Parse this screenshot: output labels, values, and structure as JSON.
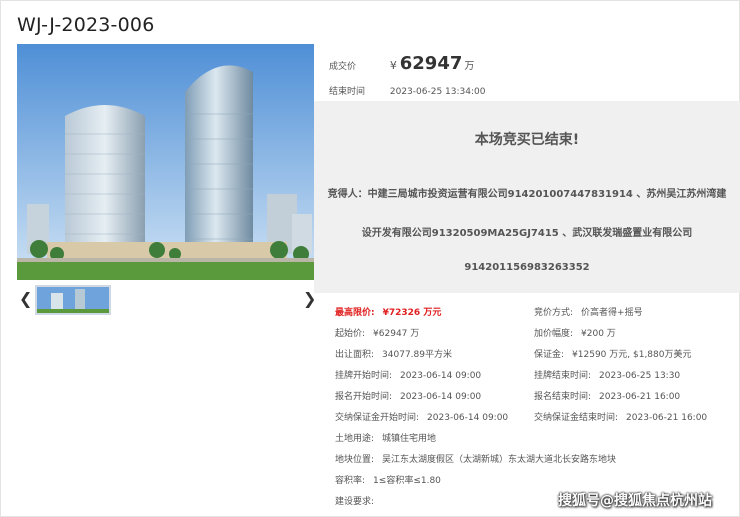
{
  "lot": {
    "code": "WJ-J-2023-006"
  },
  "summary": {
    "deal_price_label": "成交价",
    "currency": "¥",
    "deal_price": "62947",
    "unit": "万",
    "end_time_label": "结束时间",
    "end_time": "2023-06-25 13:34:00"
  },
  "ended": {
    "title": "本场竞买已结束!",
    "winner_lines": [
      "竞得人：中建三局城市投资运营有限公司914201007447831914 、苏州吴江苏州湾建",
      "设开发有限公司91320509MA25GJ7415 、武汉联发瑞盛置业有限公司",
      "914201156983263352"
    ]
  },
  "details": {
    "max_price_label": "最高限价:",
    "max_price": "¥72326 万元",
    "bid_method_label": "竞价方式:",
    "bid_method": "价高者得+摇号",
    "start_price_label": "起始价:",
    "start_price": "¥62947 万",
    "increment_label": "加价幅度:",
    "increment": "¥200 万",
    "area_label": "出让面积:",
    "area": "34077.89平方米",
    "deposit_label": "保证金:",
    "deposit": "¥12590 万元, $1,880万美元",
    "list_start_label": "挂牌开始时间:",
    "list_start": "2023-06-14 09:00",
    "list_end_label": "挂牌结束时间:",
    "list_end": "2023-06-25 13:30",
    "reg_start_label": "报名开始时间:",
    "reg_start": "2023-06-14 09:00",
    "reg_end_label": "报名结束时间:",
    "reg_end": "2023-06-21 16:00",
    "dep_start_label": "交纳保证金开始时间:",
    "dep_start": "2023-06-14 09:00",
    "dep_end_label": "交纳保证金结束时间:",
    "dep_end": "2023-06-21 16:00",
    "land_use_label": "土地用途:",
    "land_use": "城镇住宅用地",
    "location_label": "地块位置:",
    "location": "吴江东太湖度假区（太湖新城）东太湖大道北长安路东地块",
    "far_label": "容积率:",
    "far": "1≤容积率≤1.80",
    "req_label": "建设要求:",
    "req": ""
  },
  "watermark": "搜狐号@搜狐焦点杭州站",
  "colors": {
    "highlight": "#e02020",
    "panel": "#f0f0f0",
    "sky": "#7fb3e6"
  }
}
